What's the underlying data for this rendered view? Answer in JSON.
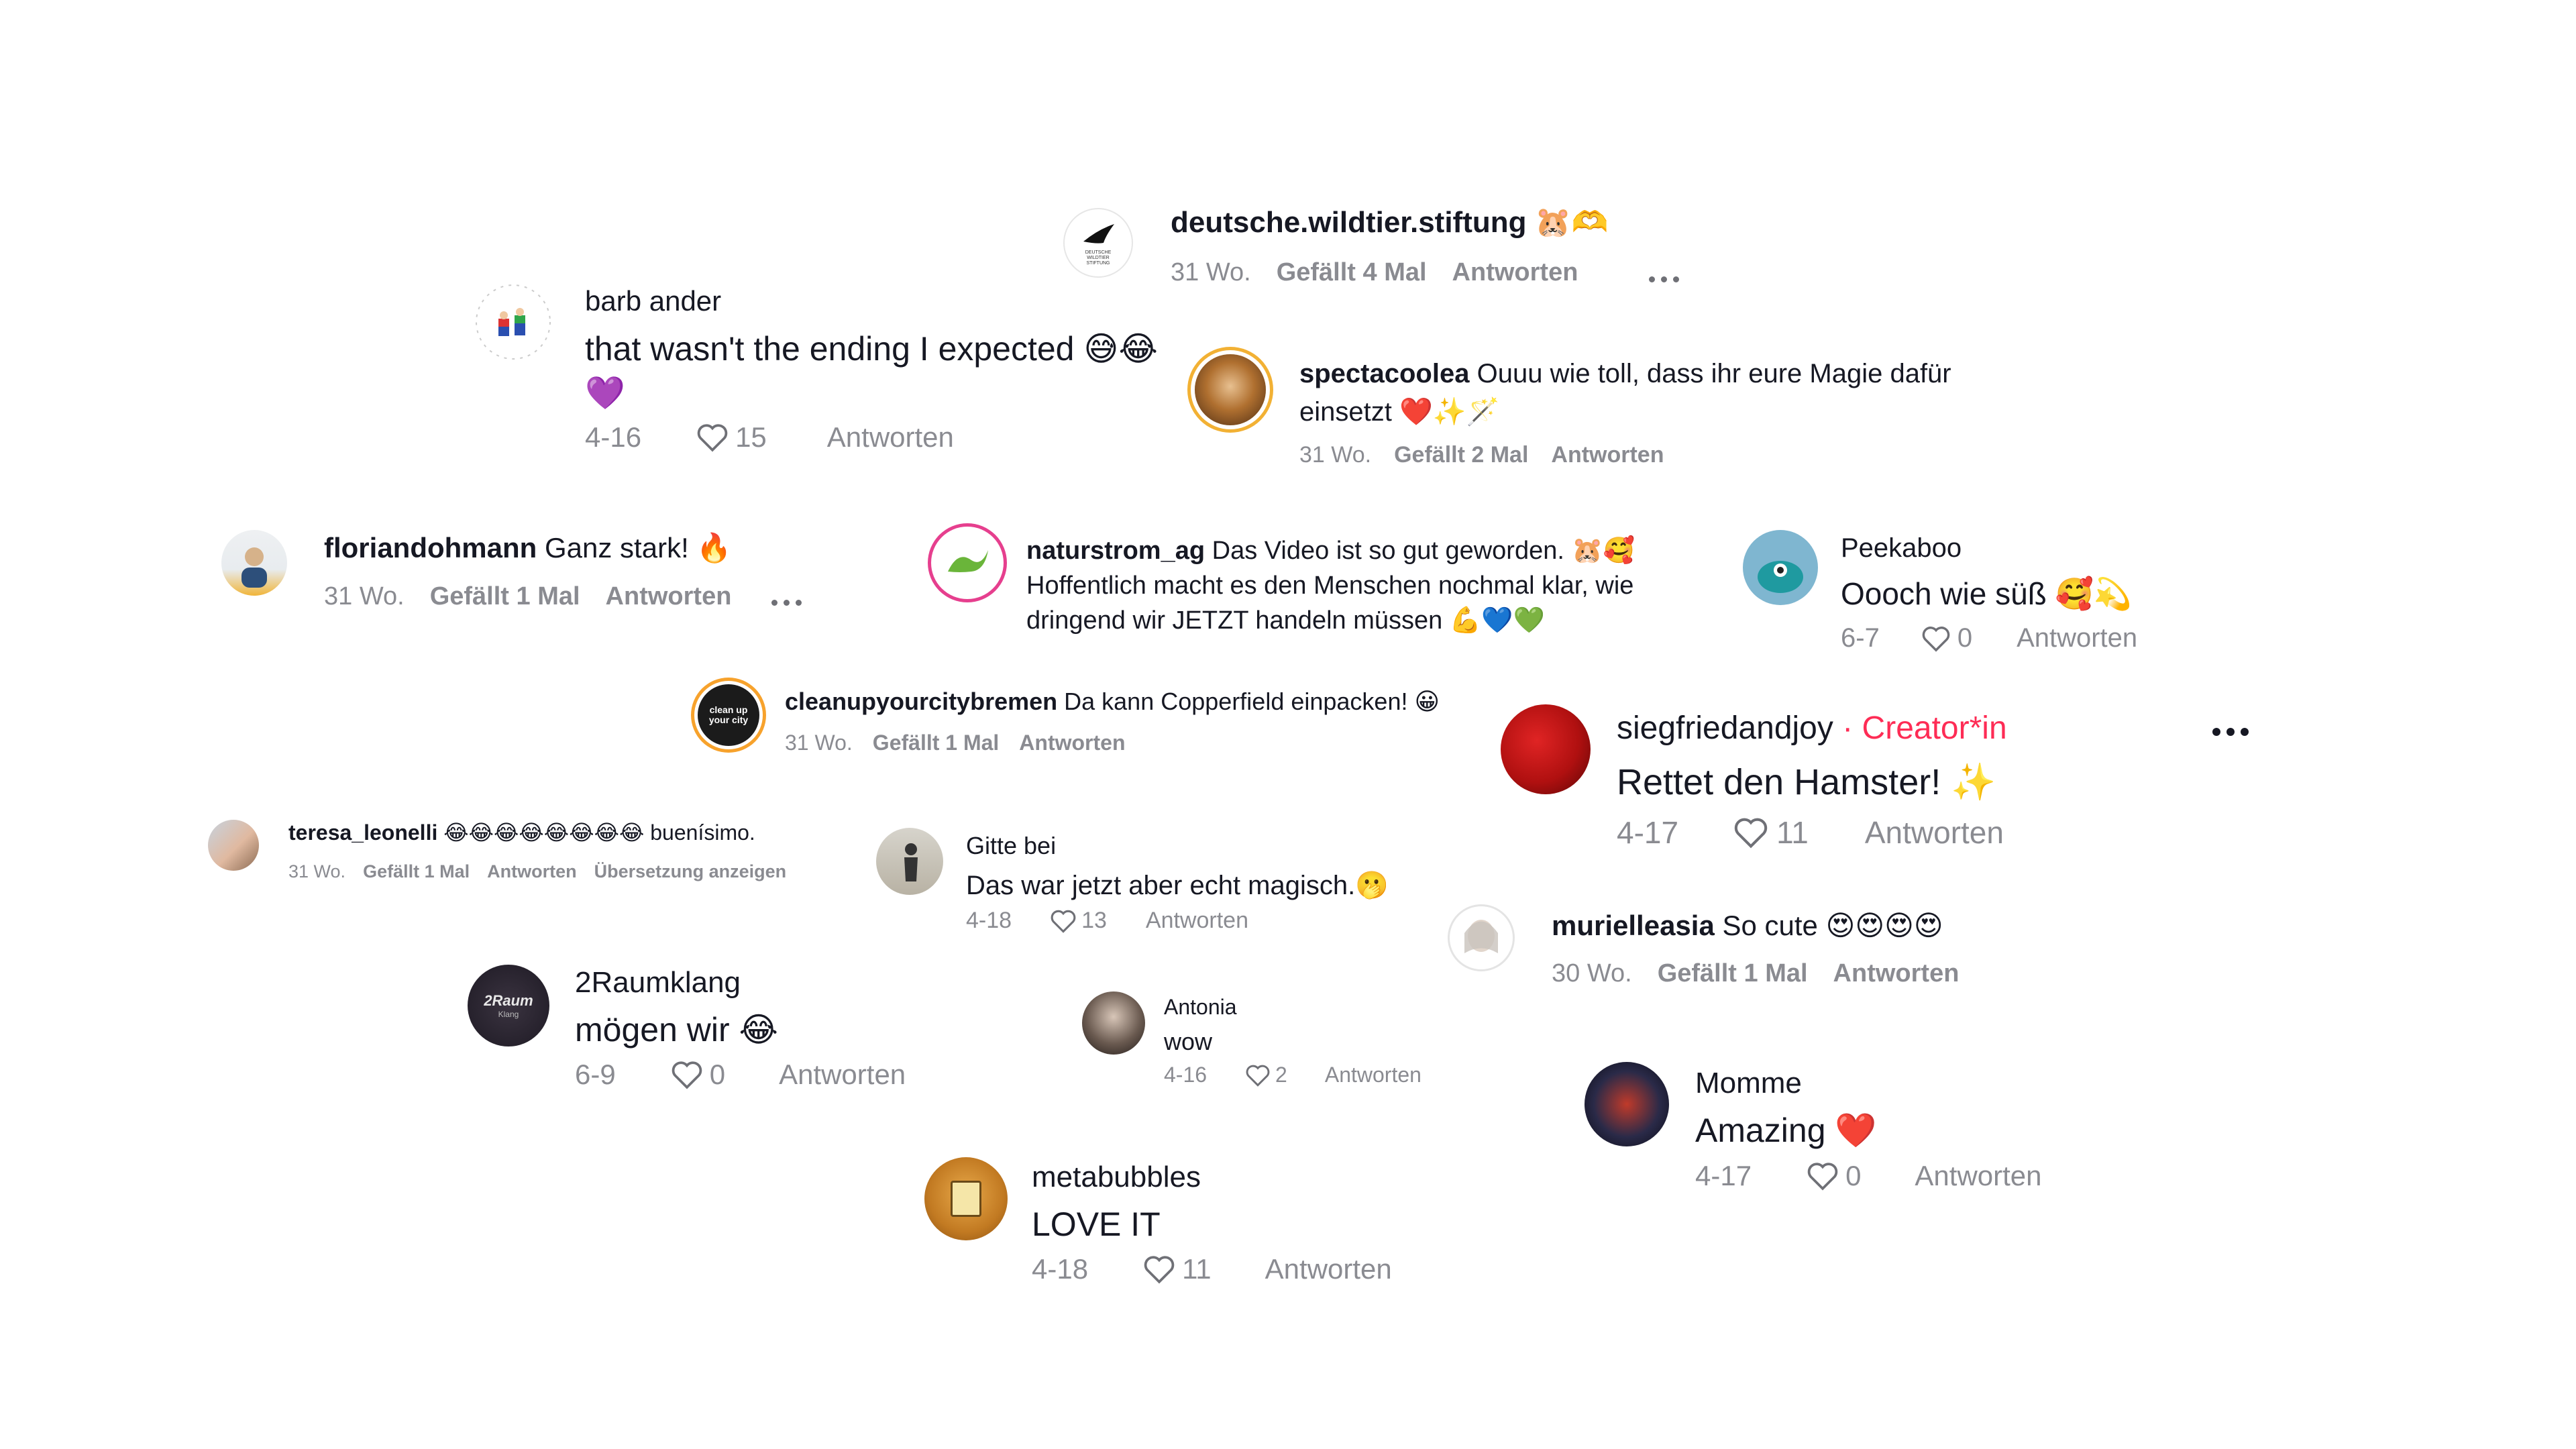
{
  "comments": {
    "deutsche": {
      "user": "deutsche.wildtier.stiftung",
      "emoji": "🐹🫶",
      "age": "31 Wo.",
      "likes": "Gefällt 4 Mal",
      "reply": "Antworten"
    },
    "barb": {
      "user": "barb ander",
      "text": "that wasn't the ending I expected 😅😂",
      "text2": "💜",
      "date": "4-16",
      "count": "15",
      "reply": "Antworten"
    },
    "spectacoolea": {
      "user": "spectacoolea",
      "text": "Ouuu wie toll, dass ihr eure Magie dafür",
      "text2": "einsetzt ❤️✨🪄",
      "age": "31 Wo.",
      "likes": "Gefällt 2 Mal",
      "reply": "Antworten"
    },
    "floriandohmann": {
      "user": "floriandohmann",
      "text": "Ganz stark! 🔥",
      "age": "31 Wo.",
      "likes": "Gefällt 1 Mal",
      "reply": "Antworten"
    },
    "naturstrom": {
      "user": "naturstrom_ag",
      "text": "Das Video ist so gut geworden. 🐹🥰",
      "text2": "Hoffentlich macht es den Menschen nochmal klar, wie",
      "text3": "dringend wir JETZT handeln müssen 💪💙💚"
    },
    "peekaboo": {
      "user": "Peekaboo",
      "text": "Oooch wie süß 🥰💫",
      "date": "6-7",
      "count": "0",
      "reply": "Antworten"
    },
    "cleanup": {
      "user": "cleanupyourcitybremen",
      "text": "Da kann Copperfield einpacken! 😀",
      "age": "31 Wo.",
      "likes": "Gefällt 1 Mal",
      "reply": "Antworten",
      "logo": "clean up your city"
    },
    "siegfried": {
      "user": "siegfriedandjoy",
      "creator": "· Creator*in",
      "text": "Rettet den Hamster! ✨",
      "date": "4-17",
      "count": "11",
      "reply": "Antworten"
    },
    "teresa": {
      "user": "teresa_leonelli",
      "text": "😂😂😂😂😂😂😂😂 buenísimo.",
      "age": "31 Wo.",
      "likes": "Gefällt 1 Mal",
      "reply": "Antworten",
      "translate": "Übersetzung anzeigen"
    },
    "gitte": {
      "user": "Gitte bei",
      "text": "Das war jetzt aber echt magisch.🫢",
      "date": "4-18",
      "count": "13",
      "reply": "Antworten"
    },
    "murielleasia": {
      "user": "murielleasia",
      "text": "So cute 😍😍😍😍",
      "age": "30 Wo.",
      "likes": "Gefällt 1 Mal",
      "reply": "Antworten"
    },
    "raumklang": {
      "user": "2Raumklang",
      "text": "mögen wir 😂",
      "date": "6-9",
      "count": "0",
      "reply": "Antworten",
      "logo": "2Raum",
      "logo_sub": "Klang"
    },
    "antonia": {
      "user": "Antonia",
      "text": "wow",
      "date": "4-16",
      "count": "2",
      "reply": "Antworten"
    },
    "momme": {
      "user": "Momme",
      "text": "Amazing ❤️",
      "date": "4-17",
      "count": "0",
      "reply": "Antworten"
    },
    "metabubbles": {
      "user": "metabubbles",
      "text": "LOVE IT",
      "date": "4-18",
      "count": "11",
      "reply": "Antworten"
    }
  },
  "colors": {
    "meta": "#8a8b91",
    "creator": "#fe2c55",
    "text": "#161823"
  }
}
